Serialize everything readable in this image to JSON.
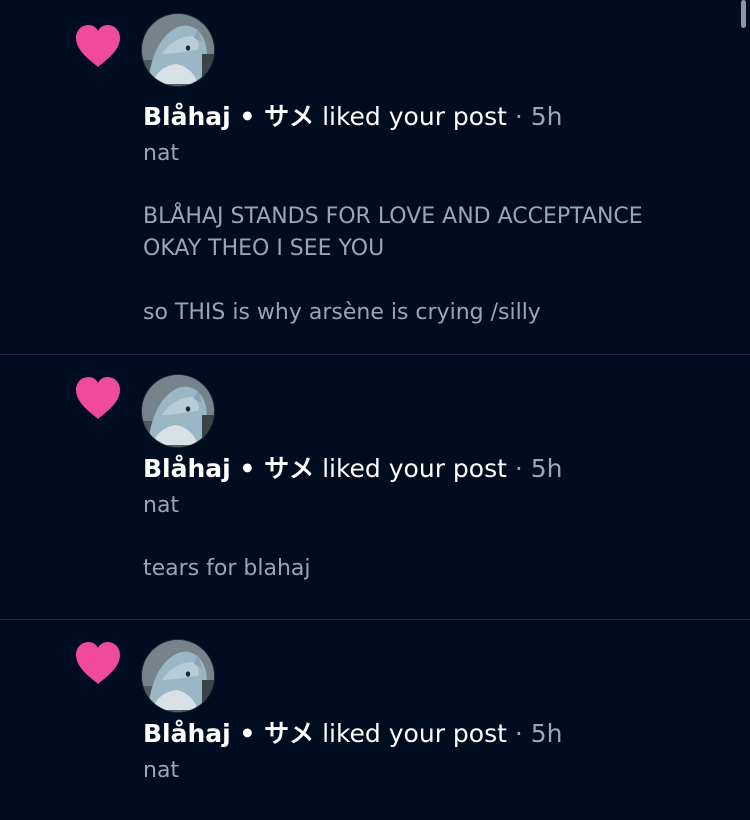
{
  "notifications": [
    {
      "actor": "Blåhaj • サメ",
      "action": "liked your post",
      "separator": "·",
      "time": "5h",
      "post_author": "nat",
      "post_text": "BLÅHAJ STANDS FOR LOVE AND ACCEPTANCE\nOKAY THEO I SEE YOU\n\nso THIS is why arsène is crying /silly"
    },
    {
      "actor": "Blåhaj • サメ",
      "action": "liked your post",
      "separator": "·",
      "time": "5h",
      "post_author": "nat",
      "post_text": "tears for blahaj"
    },
    {
      "actor": "Blåhaj • サメ",
      "action": "liked your post",
      "separator": "·",
      "time": "5h",
      "post_author": "nat",
      "post_text": ""
    }
  ],
  "icons": {
    "like": "heart-icon",
    "avatar": "shark-plush-avatar"
  },
  "colors": {
    "background": "#000c1f",
    "heart": "#f04a9f",
    "divider": "#1c2c4a",
    "muted_text": "#9aa6b8"
  }
}
